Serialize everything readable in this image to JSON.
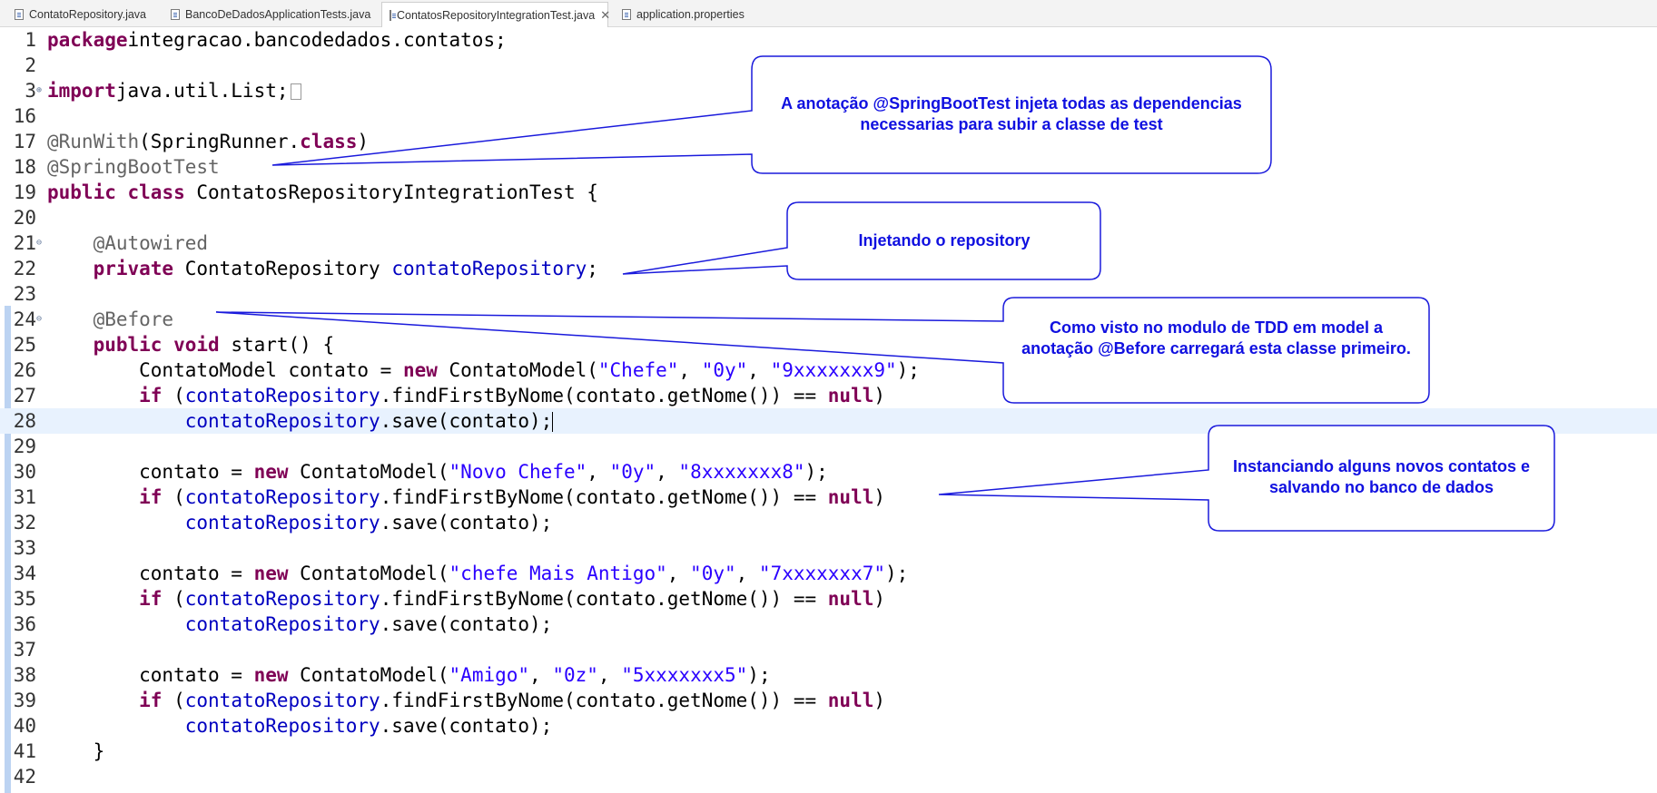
{
  "tabs": [
    {
      "label": "ContatoRepository.java",
      "active": false
    },
    {
      "label": "BancoDeDadosApplicationTests.java",
      "active": false
    },
    {
      "label": "ContatosRepositoryIntegrationTest.java",
      "active": true
    },
    {
      "label": "application.properties",
      "active": false
    }
  ],
  "tab_close_glyph": "✕",
  "code_lines": [
    {
      "num": "1",
      "tokens": [
        [
          "kw",
          "package"
        ],
        [
          "",
          "integracao.bancodedados.contatos;"
        ]
      ]
    },
    {
      "num": "2",
      "tokens": []
    },
    {
      "num": "3",
      "fold": "⊕",
      "collapsed": true,
      "tokens": [
        [
          "kw",
          "import"
        ],
        [
          "",
          "java.util.List;"
        ]
      ]
    },
    {
      "num": "16",
      "tokens": []
    },
    {
      "num": "17",
      "tokens": [
        [
          "an",
          "@RunWith"
        ],
        [
          "",
          "(SpringRunner."
        ],
        [
          "kw",
          "class"
        ],
        [
          "",
          ")"
        ]
      ]
    },
    {
      "num": "18",
      "tokens": [
        [
          "an",
          "@SpringBootTest"
        ]
      ]
    },
    {
      "num": "19",
      "tokens": [
        [
          "kw",
          "public"
        ],
        [
          "",
          " "
        ],
        [
          "kw",
          "class"
        ],
        [
          "",
          " ContatosRepositoryIntegrationTest {"
        ]
      ]
    },
    {
      "num": "20",
      "tokens": []
    },
    {
      "num": "21",
      "fold": "⊖",
      "tokens": [
        [
          "",
          "    "
        ],
        [
          "an",
          "@Autowired"
        ]
      ]
    },
    {
      "num": "22",
      "tokens": [
        [
          "",
          "    "
        ],
        [
          "kw",
          "private"
        ],
        [
          "",
          " ContatoRepository "
        ],
        [
          "fld",
          "contatoRepository"
        ],
        [
          "",
          ";"
        ]
      ]
    },
    {
      "num": "23",
      "tokens": []
    },
    {
      "num": "24",
      "fold": "⊖",
      "tokens": [
        [
          "",
          "    "
        ],
        [
          "an",
          "@Before"
        ]
      ]
    },
    {
      "num": "25",
      "tokens": [
        [
          "",
          "    "
        ],
        [
          "kw",
          "public"
        ],
        [
          "",
          " "
        ],
        [
          "kw",
          "void"
        ],
        [
          "",
          " start() {"
        ]
      ]
    },
    {
      "num": "26",
      "tokens": [
        [
          "",
          "        ContatoModel contato = "
        ],
        [
          "kw",
          "new"
        ],
        [
          "",
          " ContatoModel("
        ],
        [
          "str",
          "\"Chefe\""
        ],
        [
          "",
          ", "
        ],
        [
          "str",
          "\"0y\""
        ],
        [
          "",
          ", "
        ],
        [
          "str",
          "\"9xxxxxxx9\""
        ],
        [
          "",
          ");"
        ]
      ]
    },
    {
      "num": "27",
      "tokens": [
        [
          "",
          "        "
        ],
        [
          "kw",
          "if"
        ],
        [
          "",
          " ("
        ],
        [
          "fld",
          "contatoRepository"
        ],
        [
          "",
          ".findFirstByNome(contato.getNome()) == "
        ],
        [
          "kw",
          "null"
        ],
        [
          "",
          ")"
        ]
      ]
    },
    {
      "num": "28",
      "current": true,
      "tokens": [
        [
          "",
          "            "
        ],
        [
          "fld",
          "contatoRepository"
        ],
        [
          "",
          ".save(contato);"
        ]
      ]
    },
    {
      "num": "29",
      "tokens": []
    },
    {
      "num": "30",
      "tokens": [
        [
          "",
          "        contato = "
        ],
        [
          "kw",
          "new"
        ],
        [
          "",
          " ContatoModel("
        ],
        [
          "str",
          "\"Novo Chefe\""
        ],
        [
          "",
          ", "
        ],
        [
          "str",
          "\"0y\""
        ],
        [
          "",
          ", "
        ],
        [
          "str",
          "\"8xxxxxxx8\""
        ],
        [
          "",
          ");"
        ]
      ]
    },
    {
      "num": "31",
      "tokens": [
        [
          "",
          "        "
        ],
        [
          "kw",
          "if"
        ],
        [
          "",
          " ("
        ],
        [
          "fld",
          "contatoRepository"
        ],
        [
          "",
          ".findFirstByNome(contato.getNome()) == "
        ],
        [
          "kw",
          "null"
        ],
        [
          "",
          ")"
        ]
      ]
    },
    {
      "num": "32",
      "tokens": [
        [
          "",
          "            "
        ],
        [
          "fld",
          "contatoRepository"
        ],
        [
          "",
          ".save(contato);"
        ]
      ]
    },
    {
      "num": "33",
      "tokens": []
    },
    {
      "num": "34",
      "tokens": [
        [
          "",
          "        contato = "
        ],
        [
          "kw",
          "new"
        ],
        [
          "",
          " ContatoModel("
        ],
        [
          "str",
          "\"chefe Mais Antigo\""
        ],
        [
          "",
          ", "
        ],
        [
          "str",
          "\"0y\""
        ],
        [
          "",
          ", "
        ],
        [
          "str",
          "\"7xxxxxxx7\""
        ],
        [
          "",
          ");"
        ]
      ]
    },
    {
      "num": "35",
      "tokens": [
        [
          "",
          "        "
        ],
        [
          "kw",
          "if"
        ],
        [
          "",
          " ("
        ],
        [
          "fld",
          "contatoRepository"
        ],
        [
          "",
          ".findFirstByNome(contato.getNome()) == "
        ],
        [
          "kw",
          "null"
        ],
        [
          "",
          ")"
        ]
      ]
    },
    {
      "num": "36",
      "tokens": [
        [
          "",
          "            "
        ],
        [
          "fld",
          "contatoRepository"
        ],
        [
          "",
          ".save(contato);"
        ]
      ]
    },
    {
      "num": "37",
      "tokens": []
    },
    {
      "num": "38",
      "tokens": [
        [
          "",
          "        contato = "
        ],
        [
          "kw",
          "new"
        ],
        [
          "",
          " ContatoModel("
        ],
        [
          "str",
          "\"Amigo\""
        ],
        [
          "",
          ", "
        ],
        [
          "str",
          "\"0z\""
        ],
        [
          "",
          ", "
        ],
        [
          "str",
          "\"5xxxxxxx5\""
        ],
        [
          "",
          ");"
        ]
      ]
    },
    {
      "num": "39",
      "tokens": [
        [
          "",
          "        "
        ],
        [
          "kw",
          "if"
        ],
        [
          "",
          " ("
        ],
        [
          "fld",
          "contatoRepository"
        ],
        [
          "",
          ".findFirstByNome(contato.getNome()) == "
        ],
        [
          "kw",
          "null"
        ],
        [
          "",
          ")"
        ]
      ]
    },
    {
      "num": "40",
      "tokens": [
        [
          "",
          "            "
        ],
        [
          "fld",
          "contatoRepository"
        ],
        [
          "",
          ".save(contato);"
        ]
      ]
    },
    {
      "num": "41",
      "tokens": [
        [
          "",
          "    }"
        ]
      ]
    },
    {
      "num": "42",
      "tokens": []
    }
  ],
  "callouts": [
    {
      "text": "A anotação @SpringBootTest injeta todas as dependencias necessarias para subir a classe de test"
    },
    {
      "text": "Injetando o repository"
    },
    {
      "text": "Como visto no modulo de TDD em model a anotação @Before carregará esta classe primeiro."
    },
    {
      "text": "Instanciando alguns novos contatos e salvando no banco de dados"
    }
  ],
  "colors": {
    "keyword": "#7f0055",
    "annotation": "#646464",
    "field": "#0000c0",
    "string": "#2a00ff",
    "callout_border": "#1a1adc",
    "callout_text": "#1010e0",
    "current_line": "#e8f2fe"
  }
}
